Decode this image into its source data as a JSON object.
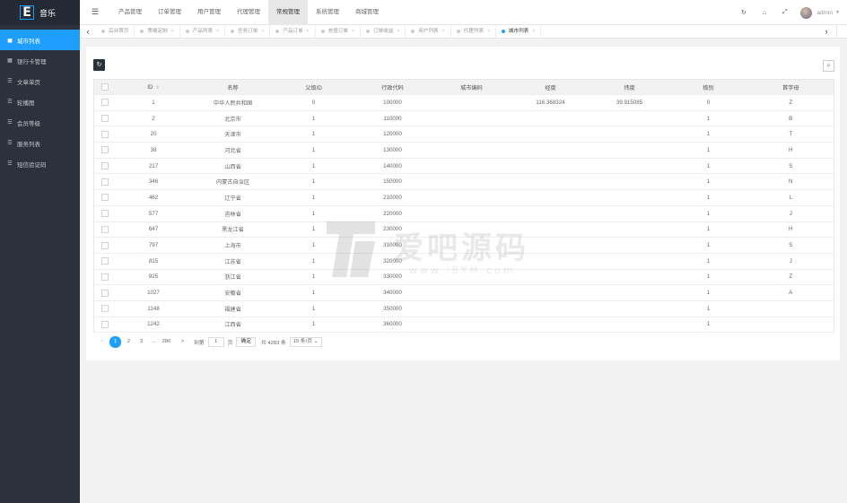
{
  "app": {
    "logo_letter": "E",
    "name": "音乐"
  },
  "sidebar": {
    "items": [
      {
        "label": "城市列表",
        "icon": "map-icon",
        "glyph": "▅",
        "active": true
      },
      {
        "label": "银行卡管理",
        "icon": "bank-icon",
        "glyph": "▦",
        "active": false
      },
      {
        "label": "文章单页",
        "icon": "list-icon",
        "glyph": "☰",
        "active": false
      },
      {
        "label": "轮播图",
        "icon": "list-icon",
        "glyph": "☰",
        "active": false
      },
      {
        "label": "会员等级",
        "icon": "list-icon",
        "glyph": "☰",
        "active": false
      },
      {
        "label": "服务列表",
        "icon": "list-icon",
        "glyph": "☰",
        "active": false
      },
      {
        "label": "短信验证码",
        "icon": "list-icon",
        "glyph": "☰",
        "active": false
      }
    ]
  },
  "header": {
    "nav": [
      "产品管理",
      "订单管理",
      "用户管理",
      "代理管理",
      "常规管理",
      "系统管理",
      "商城管理"
    ],
    "active_nav": 4,
    "user": "admin"
  },
  "tabs": [
    {
      "label": "后台首页",
      "active": false,
      "closable": false
    },
    {
      "label": "策略定制",
      "active": false,
      "closable": true
    },
    {
      "label": "产品列表",
      "active": false,
      "closable": true
    },
    {
      "label": "任务订单",
      "active": false,
      "closable": true
    },
    {
      "label": "产品订单",
      "active": false,
      "closable": true
    },
    {
      "label": "充值订单",
      "active": false,
      "closable": true
    },
    {
      "label": "订单收益",
      "active": false,
      "closable": true
    },
    {
      "label": "用户列表",
      "active": false,
      "closable": true
    },
    {
      "label": "代理列表",
      "active": false,
      "closable": true
    },
    {
      "label": "城市列表",
      "active": true,
      "closable": true
    }
  ],
  "table": {
    "columns": [
      "ID",
      "名称",
      "父级ID",
      "行政代码",
      "城市编码",
      "经度",
      "纬度",
      "级别",
      "首字母"
    ],
    "rows": [
      [
        "1",
        "中华人民共和国",
        "0",
        "100000",
        "",
        "116.368324",
        "39.915085",
        "0",
        "Z"
      ],
      [
        "2",
        "北京市",
        "1",
        "110000",
        "",
        "",
        "",
        "1",
        "B"
      ],
      [
        "20",
        "天津市",
        "1",
        "120000",
        "",
        "",
        "",
        "1",
        "T"
      ],
      [
        "38",
        "河北省",
        "1",
        "130000",
        "",
        "",
        "",
        "1",
        "H"
      ],
      [
        "217",
        "山西省",
        "1",
        "140000",
        "",
        "",
        "",
        "1",
        "S"
      ],
      [
        "346",
        "内蒙古自治区",
        "1",
        "150000",
        "",
        "",
        "",
        "1",
        "N"
      ],
      [
        "462",
        "辽宁省",
        "1",
        "210000",
        "",
        "",
        "",
        "1",
        "L"
      ],
      [
        "577",
        "吉林省",
        "1",
        "220000",
        "",
        "",
        "",
        "1",
        "J"
      ],
      [
        "647",
        "黑龙江省",
        "1",
        "230000",
        "",
        "",
        "",
        "1",
        "H"
      ],
      [
        "797",
        "上海市",
        "1",
        "310000",
        "",
        "",
        "",
        "1",
        "S"
      ],
      [
        "815",
        "江苏省",
        "1",
        "320000",
        "",
        "",
        "",
        "1",
        "J"
      ],
      [
        "925",
        "浙江省",
        "1",
        "330000",
        "",
        "",
        "",
        "1",
        "Z"
      ],
      [
        "1027",
        "安徽省",
        "1",
        "340000",
        "",
        "",
        "",
        "1",
        "A"
      ],
      [
        "1148",
        "福建省",
        "1",
        "350000",
        "",
        "",
        "",
        "1",
        ""
      ],
      [
        "1242",
        "江西省",
        "1",
        "360000",
        "",
        "",
        "",
        "1",
        ""
      ]
    ]
  },
  "pagination": {
    "prev": "<",
    "pages": [
      "1",
      "2",
      "3"
    ],
    "ellipsis": "...",
    "last": "286",
    "next": ">",
    "goto_label": "到第",
    "goto_value": "1",
    "page_unit": "页",
    "confirm": "确定",
    "total": "共 4283 条",
    "page_size": "15 条/页"
  },
  "watermark": {
    "text": "爱吧源码",
    "sub": "www.i8YM.com"
  },
  "colors": {
    "sidebar_bg": "#2b323c",
    "accent": "#1e9fff"
  }
}
